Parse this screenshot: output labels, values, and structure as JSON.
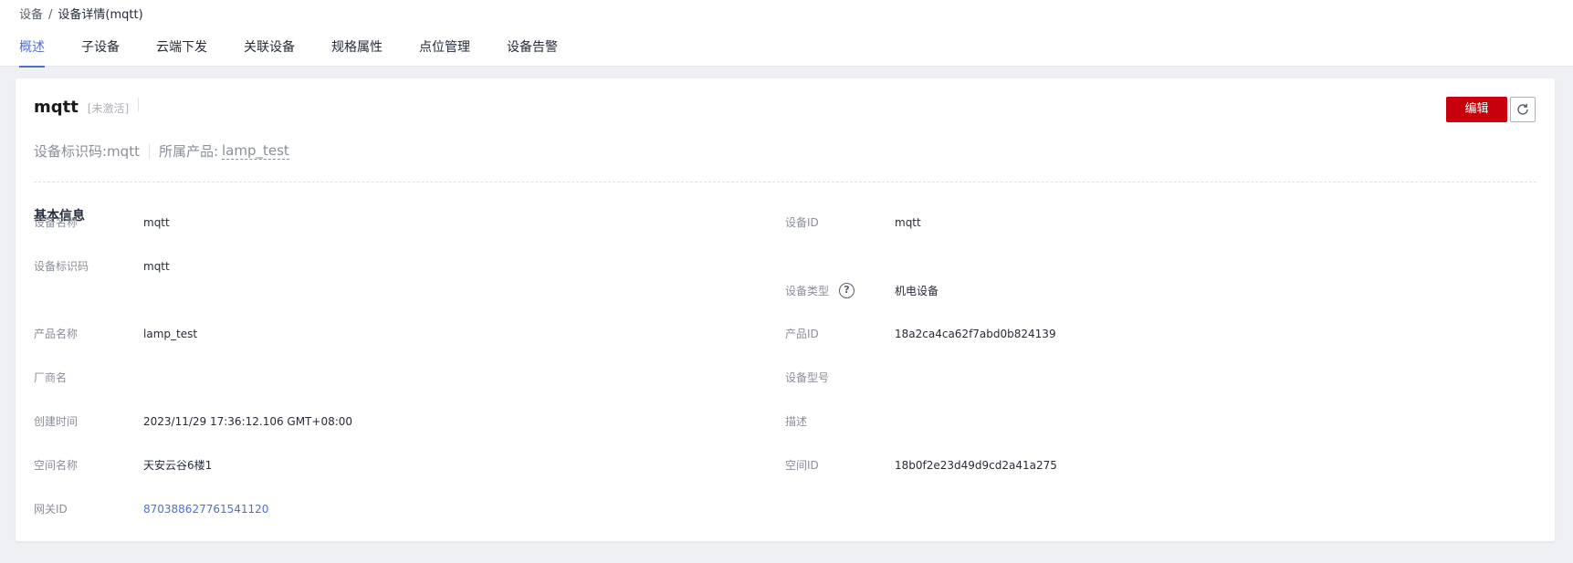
{
  "breadcrumb": {
    "parent": "设备",
    "separator": "/",
    "current": "设备详情(mqtt)"
  },
  "tabs": [
    "概述",
    "子设备",
    "云端下发",
    "关联设备",
    "规格属性",
    "点位管理",
    "设备告警"
  ],
  "active_tab": "概述",
  "device": {
    "name": "mqtt",
    "status": "[未激活]",
    "identifier_label": "设备标识码:mqtt",
    "product_label": "所属产品:",
    "product_link": "lamp_test"
  },
  "actions": {
    "edit_label": "编辑",
    "refresh_icon": "refresh-icon"
  },
  "basic_info": {
    "title": "基本信息",
    "left": [
      {
        "label": "设备名称",
        "value": "mqtt"
      },
      {
        "label": "设备标识码",
        "value": "mqtt"
      },
      {
        "label": "产品名称",
        "value": "lamp_test"
      },
      {
        "label": "厂商名",
        "value": ""
      },
      {
        "label": "创建时间",
        "value": "2023/11/29 17:36:12.106 GMT+08:00"
      },
      {
        "label": "空间名称",
        "value": "天安云谷6楼1"
      },
      {
        "label": "网关ID",
        "value": "870388627761541120"
      }
    ],
    "right": [
      {
        "label": "设备ID",
        "value": "mqtt"
      },
      {
        "label": "设备类型",
        "value": "机电设备",
        "help_icon": "?"
      },
      {
        "label": "产品ID",
        "value": "18a2ca4ca62f7abd0b824139"
      },
      {
        "label": "设备型号",
        "value": ""
      },
      {
        "label": "描述",
        "value": ""
      },
      {
        "label": "空间ID",
        "value": "18b0f2e23d49d9cd2a41a275"
      }
    ]
  },
  "colors": {
    "accent": "#526ecc",
    "primary_button": "#c7000b",
    "page_bg": "#eff0f4"
  }
}
